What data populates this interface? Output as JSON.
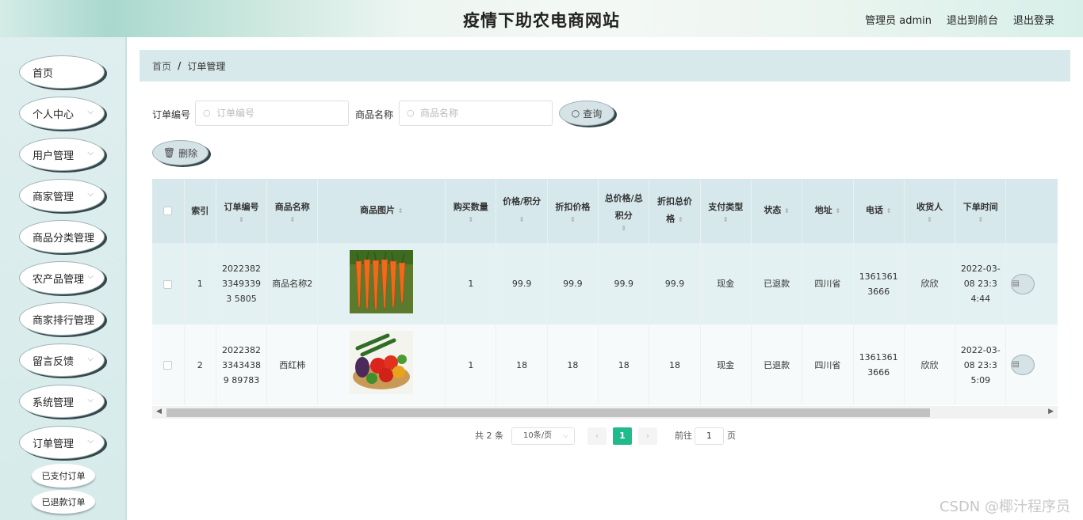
{
  "header": {
    "title": "疫情下助农电商网站",
    "links": [
      "管理员 admin",
      "退出到前台",
      "退出登录"
    ]
  },
  "sidebar": {
    "items": [
      {
        "label": "首页",
        "has_chevron": false
      },
      {
        "label": "个人中心",
        "has_chevron": true
      },
      {
        "label": "用户管理",
        "has_chevron": true
      },
      {
        "label": "商家管理",
        "has_chevron": true
      },
      {
        "label": "商品分类管理",
        "has_chevron": false
      },
      {
        "label": "农产品管理",
        "has_chevron": true
      },
      {
        "label": "商家排行管理",
        "has_chevron": false
      },
      {
        "label": "留言反馈",
        "has_chevron": true
      },
      {
        "label": "系统管理",
        "has_chevron": true
      },
      {
        "label": "订单管理",
        "has_chevron": true
      }
    ],
    "sub_items": [
      "已支付订单",
      "已退款订单"
    ]
  },
  "breadcrumb": {
    "home": "首页",
    "separator": "/",
    "current": "订单管理"
  },
  "search": {
    "order_no_label": "订单编号",
    "order_no_placeholder": "订单编号",
    "product_name_label": "商品名称",
    "product_name_placeholder": "商品名称",
    "query_button": "查询",
    "delete_button": "删除"
  },
  "table": {
    "headers": [
      "索引",
      "订单编号",
      "商品名称",
      "商品图片",
      "购买数量",
      "价格/积分",
      "折扣价格",
      "总价格/总积分",
      "折扣总价格",
      "支付类型",
      "状态",
      "地址",
      "电话",
      "收货人",
      "下单时间"
    ],
    "rows": [
      {
        "index": "1",
        "order_no": "202238233493393 5805",
        "product_name": "商品名称2",
        "image": "carrots",
        "quantity": "1",
        "price": "99.9",
        "discount_price": "99.9",
        "total_price": "99.9",
        "discount_total": "99.9",
        "pay_type": "现金",
        "status": "已退款",
        "address": "四川省",
        "phone": "13613613666",
        "receiver": "欣欣",
        "order_time": "2022-03-08 23:34:44"
      },
      {
        "index": "2",
        "order_no": "202238233434389 89783",
        "product_name": "西红柿",
        "image": "vegetables",
        "quantity": "1",
        "price": "18",
        "discount_price": "18",
        "total_price": "18",
        "discount_total": "18",
        "pay_type": "现金",
        "status": "已退款",
        "address": "四川省",
        "phone": "13613613666",
        "receiver": "欣欣",
        "order_time": "2022-03-08 23:35:09"
      }
    ]
  },
  "pagination": {
    "total": "共 2 条",
    "page_size": "10条/页",
    "current_page": "1",
    "goto_label": "前往",
    "goto_value": "1",
    "page_suffix": "页"
  },
  "watermark": "CSDN @椰汁程序员",
  "colors": {
    "accent": "#1fbb8c",
    "table_header": "#d7e8ec",
    "sidebar": "#dfeeee"
  }
}
